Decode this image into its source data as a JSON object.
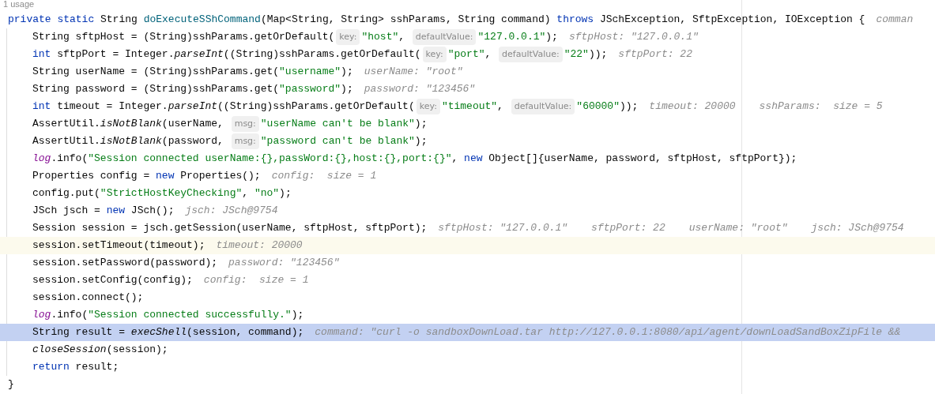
{
  "usage_hint": "1 usage",
  "method": {
    "header": [
      {
        "kind": "keyword",
        "text": "private static"
      },
      {
        "kind": "plain",
        "text": " String "
      },
      {
        "kind": "declaration",
        "text": "doExecuteSShCommand"
      },
      {
        "kind": "plain",
        "text": "(Map<String, String> sshParams, String command) "
      },
      {
        "kind": "keyword",
        "text": "throws"
      },
      {
        "kind": "plain",
        "text": " JSchException, SftpException, IOException {"
      },
      {
        "kind": "value",
        "text": "comman"
      }
    ],
    "body": [
      {
        "caret_line": false,
        "execution_point": false,
        "tokens": [
          {
            "kind": "plain",
            "text": "String sftpHost = (String)sshParams.getOrDefault("
          },
          {
            "kind": "hint",
            "text": "key:"
          },
          {
            "kind": "string",
            "text": "\"host\""
          },
          {
            "kind": "plain",
            "text": ", "
          },
          {
            "kind": "hint",
            "text": "defaultValue:"
          },
          {
            "kind": "string",
            "text": "\"127.0.0.1\""
          },
          {
            "kind": "plain",
            "text": ");"
          },
          {
            "kind": "value",
            "text": "sftpHost: \"127.0.0.1\""
          }
        ]
      },
      {
        "caret_line": false,
        "execution_point": false,
        "tokens": [
          {
            "kind": "keyword",
            "text": "int"
          },
          {
            "kind": "plain",
            "text": " sftpPort = Integer."
          },
          {
            "kind": "call",
            "text": "parseInt"
          },
          {
            "kind": "plain",
            "text": "((String)sshParams.getOrDefault("
          },
          {
            "kind": "hint",
            "text": "key:"
          },
          {
            "kind": "string",
            "text": "\"port\""
          },
          {
            "kind": "plain",
            "text": ", "
          },
          {
            "kind": "hint",
            "text": "defaultValue:"
          },
          {
            "kind": "string",
            "text": "\"22\""
          },
          {
            "kind": "plain",
            "text": "));"
          },
          {
            "kind": "value",
            "text": "sftpPort: 22"
          }
        ]
      },
      {
        "caret_line": false,
        "execution_point": false,
        "tokens": [
          {
            "kind": "plain",
            "text": "String userName = (String)sshParams.get("
          },
          {
            "kind": "string",
            "text": "\"username\""
          },
          {
            "kind": "plain",
            "text": ");"
          },
          {
            "kind": "value",
            "text": "userName: \"root\""
          }
        ]
      },
      {
        "caret_line": false,
        "execution_point": false,
        "tokens": [
          {
            "kind": "plain",
            "text": "String password = (String)sshParams.get("
          },
          {
            "kind": "string",
            "text": "\"password\""
          },
          {
            "kind": "plain",
            "text": ");"
          },
          {
            "kind": "value",
            "text": "password: \"123456\""
          }
        ]
      },
      {
        "caret_line": false,
        "execution_point": false,
        "tokens": [
          {
            "kind": "keyword",
            "text": "int"
          },
          {
            "kind": "plain",
            "text": " timeout = Integer."
          },
          {
            "kind": "call",
            "text": "parseInt"
          },
          {
            "kind": "plain",
            "text": "((String)sshParams.getOrDefault("
          },
          {
            "kind": "hint",
            "text": "key:"
          },
          {
            "kind": "string",
            "text": "\"timeout\""
          },
          {
            "kind": "plain",
            "text": ", "
          },
          {
            "kind": "hint",
            "text": "defaultValue:"
          },
          {
            "kind": "string",
            "text": "\"60000\""
          },
          {
            "kind": "plain",
            "text": "));"
          },
          {
            "kind": "value",
            "text": "timeout: 20000"
          },
          {
            "kind": "value",
            "text": "sshParams:  size = 5"
          }
        ]
      },
      {
        "caret_line": false,
        "execution_point": false,
        "tokens": [
          {
            "kind": "plain",
            "text": "AssertUtil."
          },
          {
            "kind": "call",
            "text": "isNotBlank"
          },
          {
            "kind": "plain",
            "text": "(userName, "
          },
          {
            "kind": "hint",
            "text": "msg:"
          },
          {
            "kind": "string",
            "text": "\"userName can't be blank\""
          },
          {
            "kind": "plain",
            "text": ");"
          }
        ]
      },
      {
        "caret_line": false,
        "execution_point": false,
        "tokens": [
          {
            "kind": "plain",
            "text": "AssertUtil."
          },
          {
            "kind": "call",
            "text": "isNotBlank"
          },
          {
            "kind": "plain",
            "text": "(password, "
          },
          {
            "kind": "hint",
            "text": "msg:"
          },
          {
            "kind": "string",
            "text": "\"password can't be blank\""
          },
          {
            "kind": "plain",
            "text": ");"
          }
        ]
      },
      {
        "caret_line": false,
        "execution_point": false,
        "tokens": [
          {
            "kind": "field",
            "text": "log"
          },
          {
            "kind": "plain",
            "text": ".info("
          },
          {
            "kind": "string",
            "text": "\"Session connected userName:{},passWord:{},host:{},port:{}\""
          },
          {
            "kind": "plain",
            "text": ", "
          },
          {
            "kind": "keyword",
            "text": "new"
          },
          {
            "kind": "plain",
            "text": " Object[]{userName, password, sftpHost, sftpPort});"
          }
        ]
      },
      {
        "caret_line": false,
        "execution_point": false,
        "tokens": [
          {
            "kind": "plain",
            "text": "Properties config = "
          },
          {
            "kind": "keyword",
            "text": "new"
          },
          {
            "kind": "plain",
            "text": " Properties();"
          },
          {
            "kind": "value",
            "text": "config:  size = 1"
          }
        ]
      },
      {
        "caret_line": false,
        "execution_point": false,
        "tokens": [
          {
            "kind": "plain",
            "text": "config.put("
          },
          {
            "kind": "string",
            "text": "\"StrictHostKeyChecking\""
          },
          {
            "kind": "plain",
            "text": ", "
          },
          {
            "kind": "string",
            "text": "\"no\""
          },
          {
            "kind": "plain",
            "text": ");"
          }
        ]
      },
      {
        "caret_line": false,
        "execution_point": false,
        "tokens": [
          {
            "kind": "plain",
            "text": "JSch jsch = "
          },
          {
            "kind": "keyword",
            "text": "new"
          },
          {
            "kind": "plain",
            "text": " JSch();"
          },
          {
            "kind": "value",
            "text": "jsch: JSch@9754"
          }
        ]
      },
      {
        "caret_line": false,
        "execution_point": false,
        "tokens": [
          {
            "kind": "plain",
            "text": "Session session = jsch.getSession(userName, sftpHost, sftpPort);"
          },
          {
            "kind": "value",
            "text": "sftpHost: \"127.0.0.1\""
          },
          {
            "kind": "value",
            "text": "sftpPort: 22"
          },
          {
            "kind": "value",
            "text": "userName: \"root\""
          },
          {
            "kind": "value",
            "text": "jsch: JSch@9754"
          }
        ]
      },
      {
        "caret_line": true,
        "execution_point": false,
        "tokens": [
          {
            "kind": "plain",
            "text": "session.setTimeout(timeout);"
          },
          {
            "kind": "value",
            "text": "timeout: 20000"
          }
        ]
      },
      {
        "caret_line": false,
        "execution_point": false,
        "tokens": [
          {
            "kind": "plain",
            "text": "session.setPassword(password);"
          },
          {
            "kind": "value",
            "text": "password: \"123456\""
          }
        ]
      },
      {
        "caret_line": false,
        "execution_point": false,
        "tokens": [
          {
            "kind": "plain",
            "text": "session.setConfig(config);"
          },
          {
            "kind": "value",
            "text": "config:  size = 1"
          }
        ]
      },
      {
        "caret_line": false,
        "execution_point": false,
        "tokens": [
          {
            "kind": "plain",
            "text": "session.connect();"
          }
        ]
      },
      {
        "caret_line": false,
        "execution_point": false,
        "tokens": [
          {
            "kind": "field",
            "text": "log"
          },
          {
            "kind": "plain",
            "text": ".info("
          },
          {
            "kind": "string",
            "text": "\"Session connected successfully.\""
          },
          {
            "kind": "plain",
            "text": ");"
          }
        ]
      },
      {
        "caret_line": false,
        "execution_point": true,
        "tokens": [
          {
            "kind": "plain",
            "text": "String result = "
          },
          {
            "kind": "call",
            "text": "execShell"
          },
          {
            "kind": "plain",
            "text": "(session, command);"
          },
          {
            "kind": "value",
            "text": "command: \"curl -o sandboxDownLoad.tar http://127.0.0.1:8080/api/agent/downLoadSandBoxZipFile &&"
          }
        ]
      },
      {
        "caret_line": false,
        "execution_point": false,
        "tokens": [
          {
            "kind": "call",
            "text": "closeSession"
          },
          {
            "kind": "plain",
            "text": "(session);"
          }
        ]
      },
      {
        "caret_line": false,
        "execution_point": false,
        "tokens": [
          {
            "kind": "keyword",
            "text": "return"
          },
          {
            "kind": "plain",
            "text": " result;"
          }
        ]
      }
    ],
    "footer": [
      {
        "kind": "plain",
        "text": "}"
      }
    ]
  }
}
